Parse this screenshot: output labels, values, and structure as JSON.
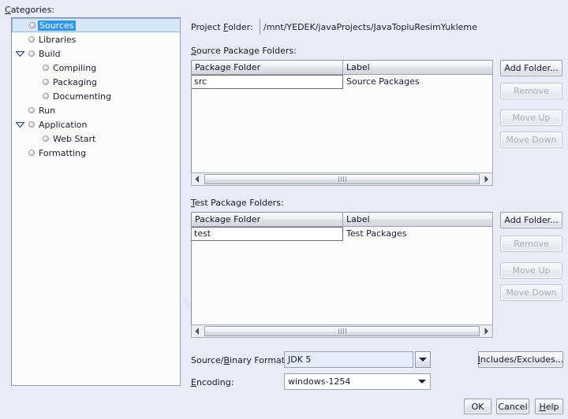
{
  "categories": {
    "label": "Categories:",
    "items": [
      {
        "label": "Sources",
        "level": 0,
        "selected": true,
        "twisty": "none"
      },
      {
        "label": "Libraries",
        "level": 0,
        "selected": false,
        "twisty": "none"
      },
      {
        "label": "Build",
        "level": 0,
        "selected": false,
        "twisty": "expanded"
      },
      {
        "label": "Compiling",
        "level": 1,
        "selected": false,
        "twisty": "none"
      },
      {
        "label": "Packaging",
        "level": 1,
        "selected": false,
        "twisty": "none"
      },
      {
        "label": "Documenting",
        "level": 1,
        "selected": false,
        "twisty": "none"
      },
      {
        "label": "Run",
        "level": 0,
        "selected": false,
        "twisty": "none"
      },
      {
        "label": "Application",
        "level": 0,
        "selected": false,
        "twisty": "expanded"
      },
      {
        "label": "Web Start",
        "level": 1,
        "selected": false,
        "twisty": "none"
      },
      {
        "label": "Formatting",
        "level": 0,
        "selected": false,
        "twisty": "none"
      }
    ]
  },
  "project_folder": {
    "label": "Project Folder:",
    "value": "/mnt/YEDEK/javaProjects/JavaTopluResimYukleme"
  },
  "source_packages": {
    "label": "Source Package Folders:",
    "columns": [
      "Package Folder",
      "Label"
    ],
    "rows": [
      {
        "folder": "src",
        "label": "Source Packages"
      }
    ],
    "buttons": {
      "add_folder": "Add Folder...",
      "remove": "Remove",
      "move_up": "Move Up",
      "move_down": "Move Down"
    }
  },
  "test_packages": {
    "label": "Test Package Folders:",
    "columns": [
      "Package Folder",
      "Label"
    ],
    "rows": [
      {
        "folder": "test",
        "label": "Test Packages"
      }
    ],
    "buttons": {
      "add_folder": "Add Folder...",
      "remove": "Remove",
      "move_up": "Move Up",
      "move_down": "Move Down"
    }
  },
  "source_format": {
    "label": "Source/Binary Format:",
    "value": "JDK 5"
  },
  "encoding": {
    "label": "Encoding:",
    "value": "windows-1254"
  },
  "includes_excludes": {
    "label": "Includes/Excludes..."
  },
  "dialog_buttons": {
    "ok": "OK",
    "cancel": "Cancel",
    "help": "Help"
  },
  "watermark": {
    "text": "w.dijitalders.com"
  },
  "colors": {
    "background": "#e9ecf6",
    "selection": "#2f96f0",
    "selection_row": "#d6e7fb",
    "field_white": "#fcfcfd",
    "combo_focus": "#e7ecf8"
  }
}
